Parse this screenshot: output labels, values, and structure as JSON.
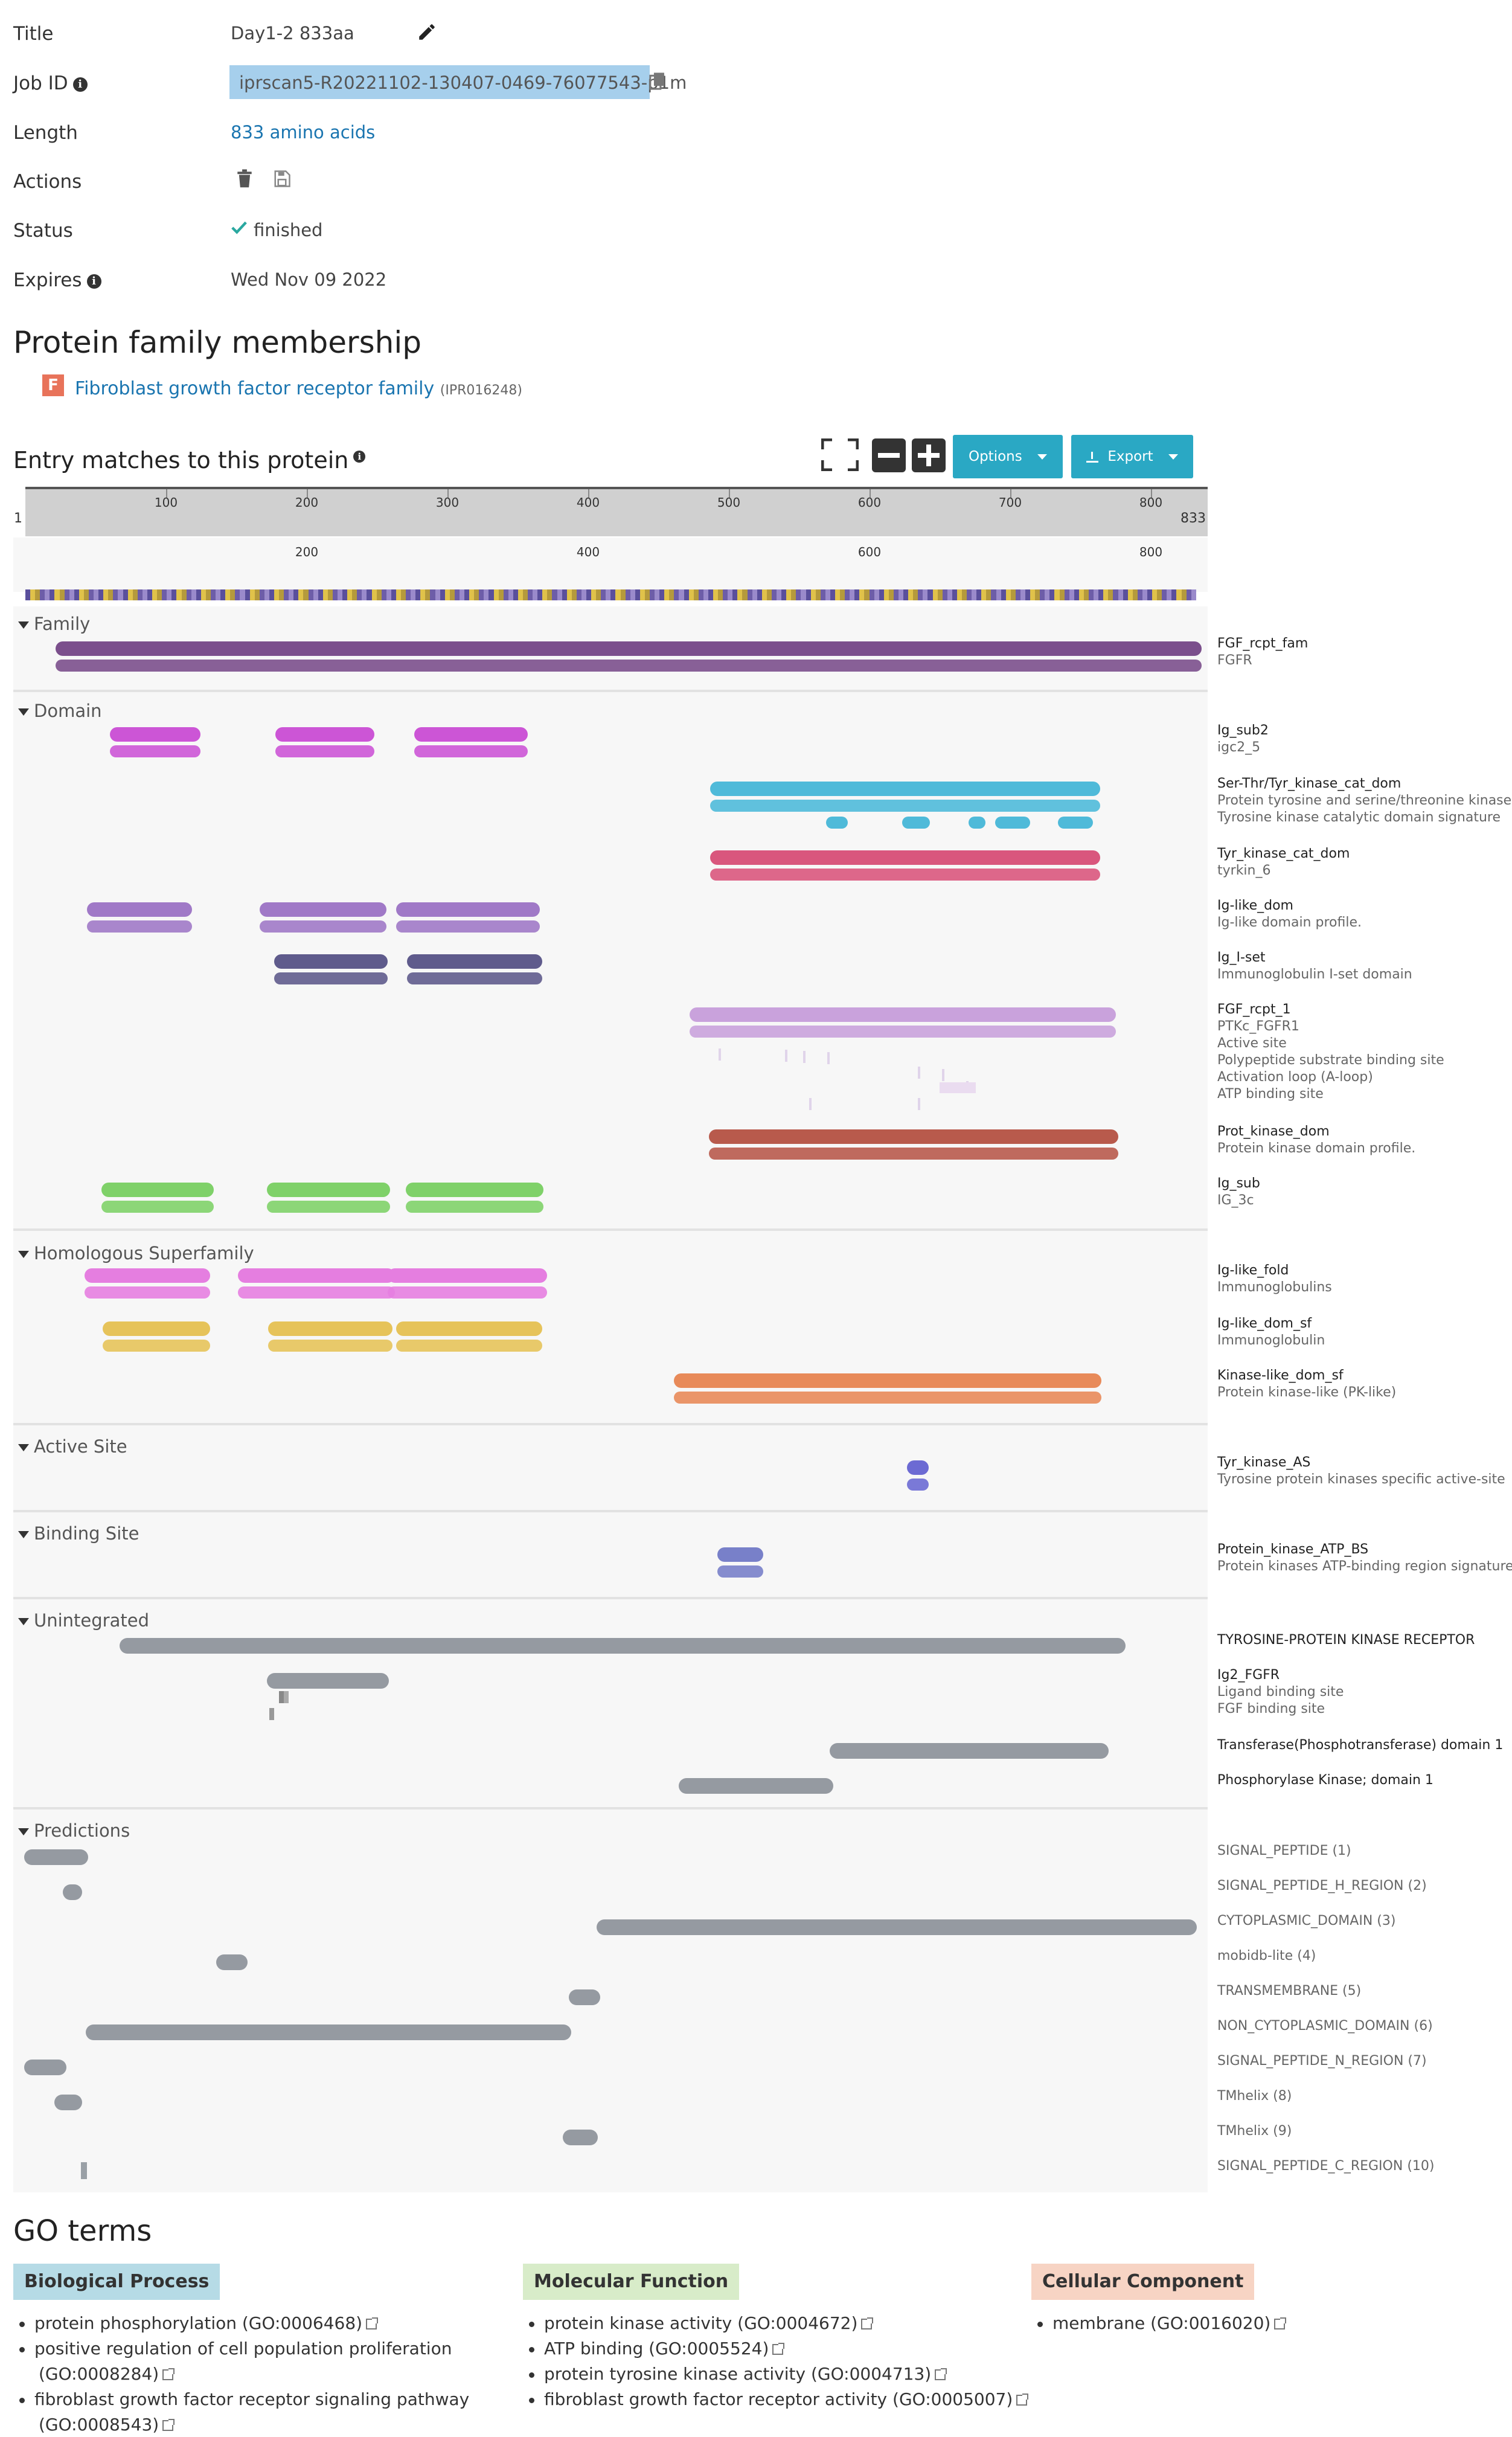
{
  "job_info": {
    "title_label": "Title",
    "title_value": "Day1-2 833aa",
    "jobid_label": "Job ID",
    "jobid_value": "iprscan5-R20221102-130407-0469-76077543-p1m",
    "length_label": "Length",
    "length_value": "833 amino acids",
    "actions_label": "Actions",
    "status_label": "Status",
    "status_value": "finished",
    "expires_label": "Expires",
    "expires_value": "Wed Nov 09 2022"
  },
  "family": {
    "heading": "Protein family membership",
    "badge": "F",
    "name": "Fibroblast growth factor receptor family",
    "accession": "(IPR016248)"
  },
  "entry_matches": {
    "heading": "Entry matches to this protein",
    "options_label": "Options",
    "export_label": "Export",
    "ruler": {
      "start": "1",
      "end": "833",
      "ticks": [
        "100",
        "200",
        "300",
        "400",
        "500",
        "600",
        "700",
        "800"
      ],
      "zoom_ticks": [
        "200",
        "400",
        "600",
        "800"
      ]
    },
    "categories": {
      "family": "Family",
      "domain": "Domain",
      "homologous": "Homologous Superfamily",
      "active": "Active Site",
      "binding": "Binding Site",
      "unintegrated": "Unintegrated",
      "predictions": "Predictions"
    },
    "labels": {
      "fgf_fam": "FGF_rcpt_fam",
      "fgfr": "FGFR",
      "ig_sub2": "Ig_sub2",
      "igc2_5": "igc2_5",
      "sertyr": "Ser-Thr/Tyr_kinase_cat_dom",
      "sertyr_sub1": "Protein tyrosine and serine/threonine kinase",
      "sertyr_sub2": "Tyrosine kinase catalytic domain signature",
      "tyr_cat": "Tyr_kinase_cat_dom",
      "tyrkin6": "tyrkin_6",
      "iglike": "Ig-like_dom",
      "iglike_sub": "Ig-like domain profile.",
      "igiset": "Ig_I-set",
      "igiset_sub": "Immunoglobulin I-set domain",
      "fgf1": "FGF_rcpt_1",
      "fgf1_s1": "PTKc_FGFR1",
      "fgf1_s2": "Active site",
      "fgf1_s3": "Polypeptide substrate binding site",
      "fgf1_s4": "Activation loop (A-loop)",
      "fgf1_s5": "ATP binding site",
      "protkin": "Prot_kinase_dom",
      "protkin_sub": "Protein kinase domain profile.",
      "igsub": "Ig_sub",
      "ig3c": "IG_3c",
      "iglikefold": "Ig-like_fold",
      "iglikefold_sub": "Immunoglobulins",
      "iglikesf": "Ig-like_dom_sf",
      "iglikesf_sub": "Immunoglobulin",
      "kinlike": "Kinase-like_dom_sf",
      "kinlike_sub": "Protein kinase-like (PK-like)",
      "tyras": "Tyr_kinase_AS",
      "tyras_sub": "Tyrosine protein kinases specific active-site",
      "atpbs": "Protein_kinase_ATP_BS",
      "atpbs_sub": "Protein kinases ATP-binding region signature",
      "tyrrec": "TYROSINE-PROTEIN KINASE RECEPTOR",
      "ig2fgfr": "Ig2_FGFR",
      "ig2fgfr_s1": "Ligand binding site",
      "ig2fgfr_s2": "FGF binding site",
      "transf": "Transferase(Phosphotransferase) domain 1",
      "phosph": "Phosphorylase Kinase; domain 1"
    },
    "predictions": [
      "SIGNAL_PEPTIDE (1)",
      "SIGNAL_PEPTIDE_H_REGION (2)",
      "CYTOPLASMIC_DOMAIN (3)",
      "mobidb-lite (4)",
      "TRANSMEMBRANE (5)",
      "NON_CYTOPLASMIC_DOMAIN (6)",
      "SIGNAL_PEPTIDE_N_REGION (7)",
      "TMhelix (8)",
      "TMhelix (9)",
      "SIGNAL_PEPTIDE_C_REGION (10)"
    ]
  },
  "go_terms": {
    "heading": "GO terms",
    "bp_label": "Biological Process",
    "mf_label": "Molecular Function",
    "cc_label": "Cellular Component",
    "bp": [
      "protein phosphorylation (GO:0006468)",
      "positive regulation of cell population proliferation",
      "(GO:0008284)",
      "fibroblast growth factor receptor signaling pathway",
      "(GO:0008543)"
    ],
    "mf": [
      "protein kinase activity (GO:0004672)",
      "ATP binding (GO:0005524)",
      "protein tyrosine kinase activity (GO:0004713)",
      "fibroblast growth factor receptor activity (GO:0005007)"
    ],
    "cc": [
      "membrane (GO:0016020)"
    ]
  },
  "colors": {
    "family": "#7b4f8c",
    "ig_sub2": "#cc55d6",
    "sertyr": "#4fbad9",
    "tyr_cat": "#d9567d",
    "iglike": "#a079c7",
    "igiset": "#5f5b8c",
    "fgf1": "#c9a2dc",
    "protkin": "#b85a4c",
    "igsub": "#7fd169",
    "iglikefold": "#e57ee0",
    "iglikesf": "#e6c35a",
    "kinlike": "#e88a59",
    "active": "#6c6ad3",
    "binding": "#7880c9",
    "grey": "#959aa1",
    "bp_bg": "#b6dbe6",
    "mf_bg": "#d8ecc9",
    "cc_bg": "#f7d4c4",
    "teal": "#2aa8c4"
  }
}
